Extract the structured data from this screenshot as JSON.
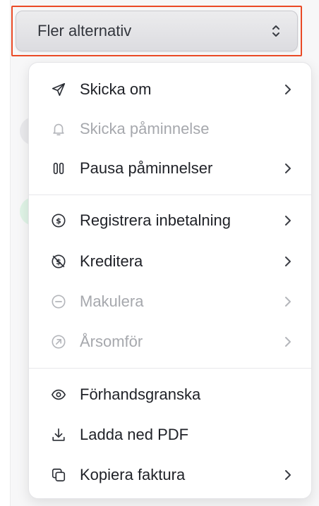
{
  "select": {
    "label": "Fler alternativ",
    "icon": "chevron-up-down-icon"
  },
  "colors": {
    "focus_outline": "#ea4a26",
    "text_primary": "#1f2127",
    "text_disabled": "#a6a8ad"
  },
  "menu": {
    "groups": [
      {
        "items": [
          {
            "label": "Skicka om",
            "icon": "send-icon",
            "disabled": false,
            "has_submenu": true
          },
          {
            "label": "Skicka påminnelse",
            "icon": "bell-icon",
            "disabled": true,
            "has_submenu": false
          },
          {
            "label": "Pausa påminnelser",
            "icon": "pause-icon",
            "disabled": false,
            "has_submenu": true
          }
        ]
      },
      {
        "items": [
          {
            "label": "Registrera inbetalning",
            "icon": "dollar-circle-icon",
            "disabled": false,
            "has_submenu": true
          },
          {
            "label": "Kreditera",
            "icon": "dollar-crossed-icon",
            "disabled": false,
            "has_submenu": true
          },
          {
            "label": "Makulera",
            "icon": "minus-circle-icon",
            "disabled": true,
            "has_submenu": true
          },
          {
            "label": "Årsomför",
            "icon": "arrow-up-right-circle-icon",
            "disabled": true,
            "has_submenu": true
          }
        ]
      },
      {
        "items": [
          {
            "label": "Förhandsgranska",
            "icon": "eye-icon",
            "disabled": false,
            "has_submenu": false
          },
          {
            "label": "Ladda ned PDF",
            "icon": "download-icon",
            "disabled": false,
            "has_submenu": false
          },
          {
            "label": "Kopiera faktura",
            "icon": "copy-icon",
            "disabled": false,
            "has_submenu": true
          }
        ]
      }
    ]
  }
}
